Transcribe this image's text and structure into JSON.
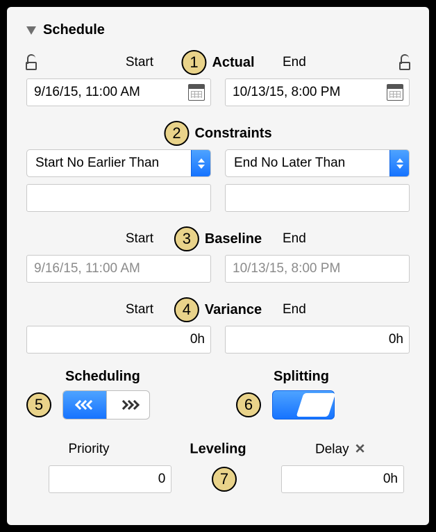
{
  "section": {
    "title": "Schedule"
  },
  "actual": {
    "title": "Actual",
    "start_label": "Start",
    "end_label": "End",
    "start_value": "9/16/15, 11:00 AM",
    "end_value": "10/13/15, 8:00 PM"
  },
  "constraints": {
    "title": "Constraints",
    "start_option": "Start No Earlier Than",
    "end_option": "End No Later Than",
    "start_value": "",
    "end_value": ""
  },
  "baseline": {
    "title": "Baseline",
    "start_label": "Start",
    "end_label": "End",
    "start_value": "9/16/15, 11:00 AM",
    "end_value": "10/13/15, 8:00 PM"
  },
  "variance": {
    "title": "Variance",
    "start_label": "Start",
    "end_label": "End",
    "start_value": "0h",
    "end_value": "0h"
  },
  "scheduling": {
    "title": "Scheduling",
    "direction": "backward"
  },
  "splitting": {
    "title": "Splitting",
    "enabled": true
  },
  "leveling": {
    "title": "Leveling",
    "priority_label": "Priority",
    "priority_value": "0",
    "delay_label": "Delay",
    "delay_value": "0h"
  },
  "annotations": {
    "n1": "1",
    "n2": "2",
    "n3": "3",
    "n4": "4",
    "n5": "5",
    "n6": "6",
    "n7": "7"
  }
}
